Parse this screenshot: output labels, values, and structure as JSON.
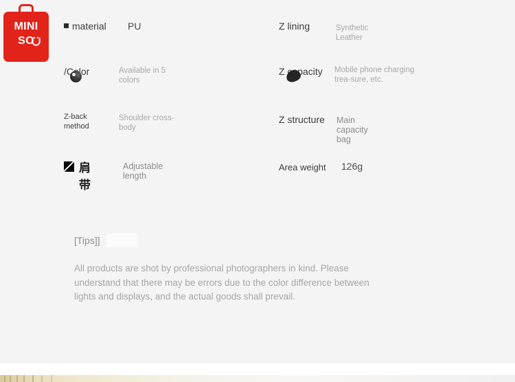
{
  "brand": {
    "logo_line1": "MINI",
    "logo_line2": "SO",
    "logo_alt": "MINISO",
    "logo_color": "#e2231a"
  },
  "specs": {
    "rows": [
      {
        "left": {
          "label": "material",
          "value": "PU",
          "bullet": true,
          "value_style": "strong"
        },
        "right": {
          "label": "Z lining",
          "value": "Synthetic Leather"
        }
      },
      {
        "left": {
          "label": "/Color",
          "value": "Available in 5 colors",
          "icon": "color-sphere-icon"
        },
        "right": {
          "label": "Z capacity",
          "value": "Mobile phone charging trea-sure, etc.",
          "icon": "capacity-blob-icon"
        }
      },
      {
        "left": {
          "label": "Z-back method",
          "value": "Shoulder cross-body",
          "label_small": true
        },
        "right": {
          "label": "Z structure",
          "value": "Main capacity bag",
          "value_style": "mid"
        }
      },
      {
        "left": {
          "label": "肩带",
          "value": "Adjustable length",
          "icon": "slash-square-icon",
          "value_style": "mid"
        },
        "right": {
          "label": "Area weight",
          "value": "126g",
          "value_style": "strong"
        }
      }
    ]
  },
  "tips": {
    "title": "[Tips]]",
    "body": "All products are shot by professional photographers in kind. Please understand that there may be errors due to the color difference between lights and displays, and the actual goods shall prevail."
  },
  "colors": {
    "panel_background": "#f4f4f4",
    "label_text": "#3c3c3c",
    "value_text": "#a8a8a8",
    "tips_text": "#a6a6a6",
    "brand_red": "#e2231a"
  }
}
